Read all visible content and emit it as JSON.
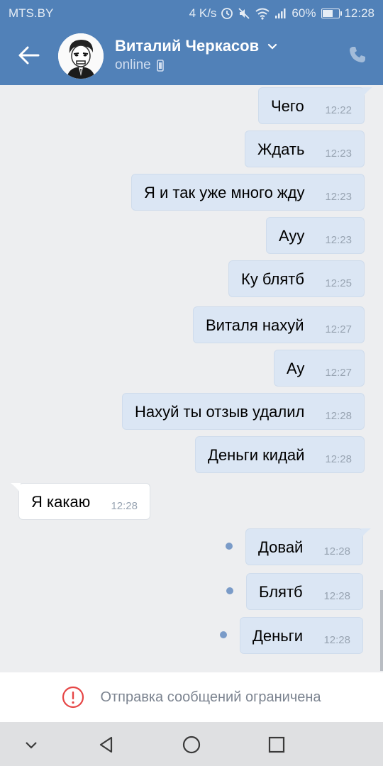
{
  "status_bar": {
    "carrier": "MTS.BY",
    "speed": "4 K/s",
    "battery": "60%",
    "battery_level": 0.6,
    "time": "12:28"
  },
  "header": {
    "contact_name": "Виталий Черкасов",
    "status": "online",
    "icons": [
      "back-arrow-icon",
      "chevron-down-icon",
      "mobile-icon",
      "phone-icon"
    ]
  },
  "messages": [
    {
      "text": "Чего",
      "time": "12:22",
      "dir": "out"
    },
    {
      "text": "Ждать",
      "time": "12:23",
      "dir": "out"
    },
    {
      "text": "Я и так уже много жду",
      "time": "12:23",
      "dir": "out"
    },
    {
      "text": "Ауу",
      "time": "12:23",
      "dir": "out"
    },
    {
      "text": "Ку блятб",
      "time": "12:25",
      "dir": "out"
    },
    {
      "text": "Виталя нахуй",
      "time": "12:27",
      "dir": "out"
    },
    {
      "text": "Ау",
      "time": "12:27",
      "dir": "out"
    },
    {
      "text": "Нахуй ты отзыв удалил",
      "time": "12:28",
      "dir": "out"
    },
    {
      "text": "Деньги кидай",
      "time": "12:28",
      "dir": "out"
    },
    {
      "text": "Я какаю",
      "time": "12:28",
      "dir": "in"
    },
    {
      "text": "Довай",
      "time": "12:28",
      "dir": "out",
      "unread": true
    },
    {
      "text": "Блятб",
      "time": "12:28",
      "dir": "out",
      "unread": true
    },
    {
      "text": "Деньги",
      "time": "12:28",
      "dir": "out",
      "unread": true
    }
  ],
  "restricted_bar": {
    "text": "Отправка сообщений ограничена",
    "icon": "error-circle-icon",
    "icon_color": "#e64646"
  },
  "nav_bar": {
    "icons": [
      "hide-keyboard-icon",
      "back-icon",
      "home-icon",
      "recents-icon"
    ]
  },
  "colors": {
    "header": "#5181b8",
    "chat_bg": "#edeef0",
    "outgoing_bubble": "#dbe6f4",
    "incoming_bubble": "#ffffff"
  }
}
